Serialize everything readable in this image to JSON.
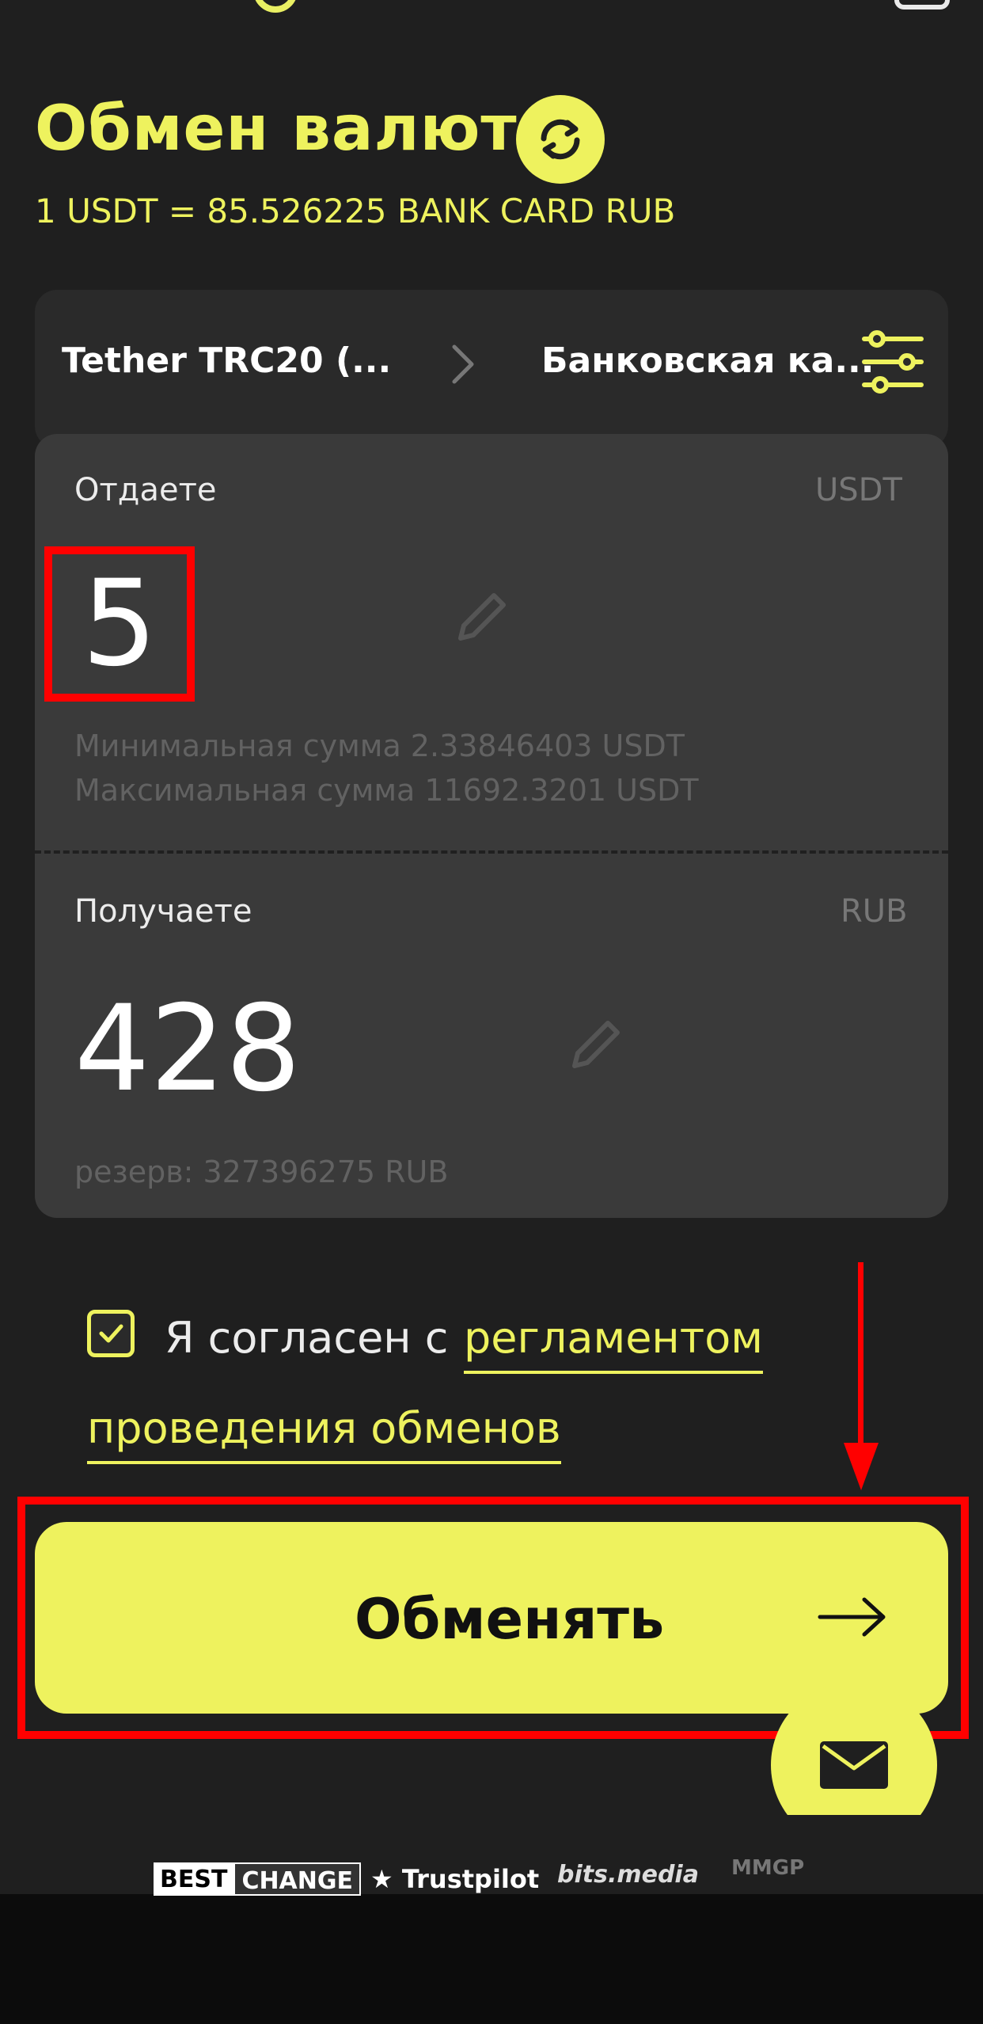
{
  "colors": {
    "accent": "#eef25e",
    "background": "#1f1f1f",
    "panel": "#3a3a3a",
    "annotation": "#ff0000"
  },
  "page": {
    "title": "Обмен валют",
    "rate": "1 USDT = 85.526225 BANK CARD RUB"
  },
  "pair": {
    "from": "Tether TRC20 (...",
    "to": "Банковская ка..."
  },
  "give": {
    "label": "Отдаете",
    "currency": "USDT",
    "value": "5",
    "min": "Минимальная сумма 2.33846403 USDT",
    "max": "Максимальная сумма 11692.3201 USDT"
  },
  "get": {
    "label": "Получаете",
    "currency": "RUB",
    "value": "428",
    "reserve": "резерв: 327396275 RUB"
  },
  "agreement": {
    "checked": true,
    "text": "Я согласен с",
    "link_line1": "регламентом",
    "link_line2": "проведения обменов"
  },
  "exchange_button": {
    "label": "Обменять",
    "icon": "arrow-right-icon"
  },
  "footer": {
    "bestchange_a": "BEST",
    "bestchange_b": "CHANGE",
    "trustpilot": "Trustpilot",
    "bitsmedia": "bits.media",
    "mmgp": "MMGP"
  }
}
